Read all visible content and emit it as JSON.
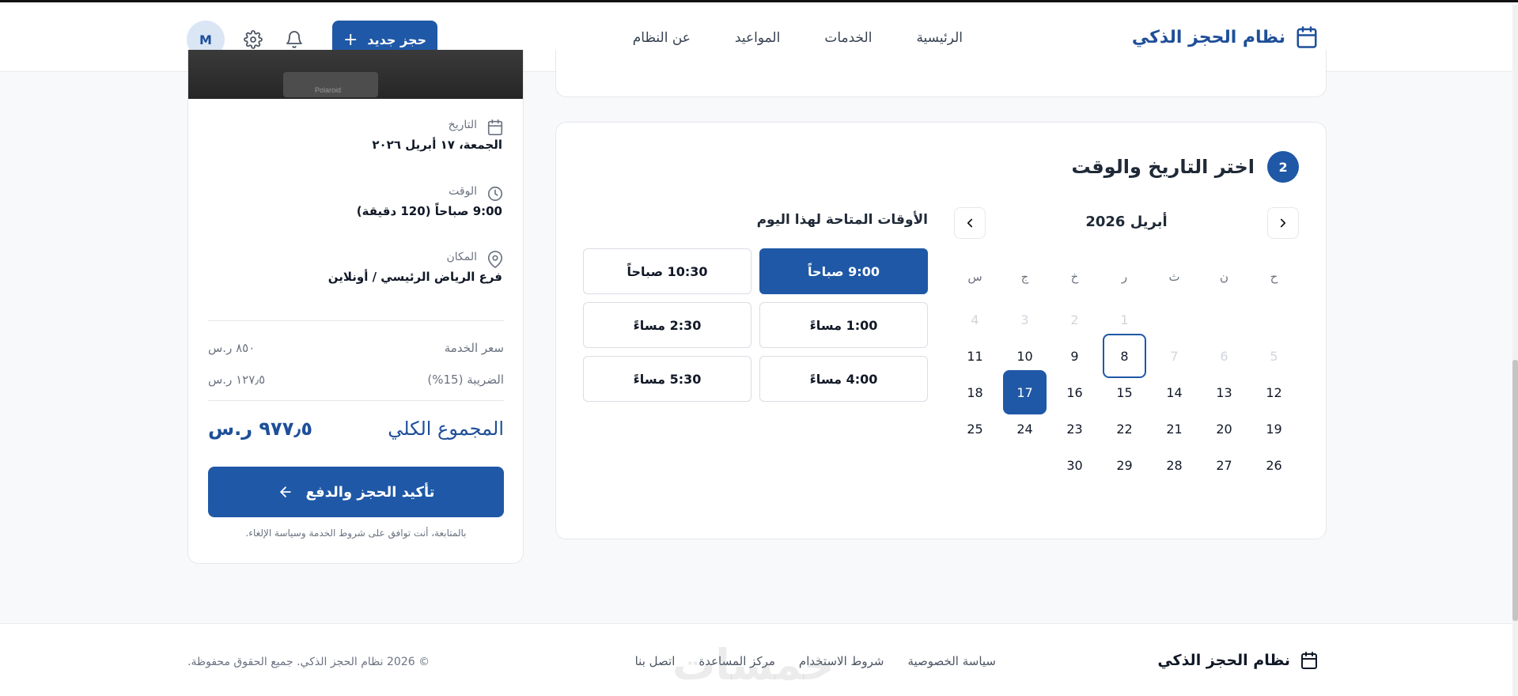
{
  "header": {
    "brand": "نظام الحجز الذكي",
    "nav": [
      "الرئيسية",
      "الخدمات",
      "المواعيد",
      "عن النظام"
    ],
    "new_booking": "حجز جديد",
    "avatar": "M"
  },
  "summary": {
    "image_caption": "Polaroid",
    "date_label": "التاريخ",
    "date_value": "الجمعة، ١٧ أبريل ٢٠٢٦",
    "time_label": "الوقت",
    "time_value": "9:00 صباحاً (120 دقيقة)",
    "location_label": "المكان",
    "location_value": "فرع الرياض الرئيسي / أونلاين",
    "service_price_label": "سعر الخدمة",
    "service_price_value": "٨٥٠ ر.س",
    "tax_label": "الضريبة (15%)",
    "tax_value": "١٢٧٫٥ ر.س",
    "total_label": "المجموع الكلي",
    "total_value": "٩٧٧٫٥ ر.س",
    "confirm_button": "تأكيد الحجز والدفع",
    "terms": "بالمتابعة، أنت توافق على شروط الخدمة وسياسة الإلغاء."
  },
  "step": {
    "number": "2",
    "title": "اختر التاريخ والوقت"
  },
  "calendar": {
    "month": "أبريل 2026",
    "weekdays": [
      "ح",
      "ن",
      "ث",
      "ر",
      "خ",
      "ج",
      "س"
    ],
    "weeks": [
      [
        "",
        "",
        "",
        "1",
        "2",
        "3",
        "4"
      ],
      [
        "5",
        "6",
        "7",
        "8",
        "9",
        "10",
        "11"
      ],
      [
        "12",
        "13",
        "14",
        "15",
        "16",
        "17",
        "18"
      ],
      [
        "19",
        "20",
        "21",
        "22",
        "23",
        "24",
        "25"
      ],
      [
        "26",
        "27",
        "28",
        "29",
        "30",
        "",
        ""
      ]
    ],
    "today": "8",
    "selected": "17",
    "disabled": [
      "1",
      "2",
      "3",
      "4",
      "5",
      "6",
      "7"
    ]
  },
  "slots": {
    "title": "الأوقات المتاحة لهذا اليوم",
    "items": [
      "9:00 صباحاً",
      "10:30 صباحاً",
      "1:00 مساءً",
      "2:30 مساءً",
      "4:00 مساءً",
      "5:30 مساءً"
    ],
    "selected": "9:00 صباحاً"
  },
  "footer": {
    "brand": "نظام الحجز الذكي",
    "links": [
      "سياسة الخصوصية",
      "شروط الاستخدام",
      "مركز المساعدة",
      "اتصل بنا"
    ],
    "copyright": "© 2026 نظام الحجز الذكي. جميع الحقوق محفوظة.",
    "watermark": "خمسات"
  },
  "colors": {
    "primary": "#1f58a6",
    "brand_text": "#1e4f99",
    "background": "#f8f9fb"
  }
}
